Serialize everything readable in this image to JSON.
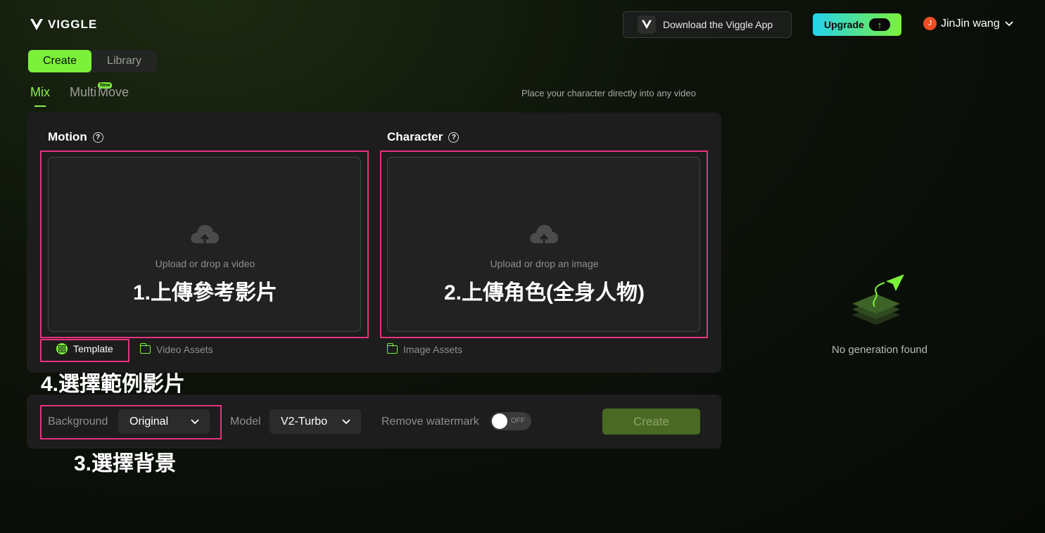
{
  "header": {
    "logo_text": "VIGGLE",
    "download_label": "Download the Viggle App",
    "upgrade_label": "Upgrade",
    "user_initial": "J",
    "user_name": "JinJin wang"
  },
  "main_tabs": [
    {
      "label": "Create",
      "active": true
    },
    {
      "label": "Library",
      "active": false
    }
  ],
  "mode_tabs": [
    {
      "label": "Mix",
      "active": true
    },
    {
      "label": "Multi",
      "badge": "New"
    },
    {
      "label": "Move"
    }
  ],
  "subtitle": "Place your character directly into any video",
  "motion": {
    "title": "Motion",
    "hint": "Upload or drop a video",
    "annotation": "1.上傳參考影片",
    "template_label": "Template",
    "assets_label": "Video Assets"
  },
  "character": {
    "title": "Character",
    "hint": "Upload or drop an image",
    "annotation": "2.上傳角色(全身人物)",
    "assets_label": "Image Assets"
  },
  "annotations": {
    "template": "4.選擇範例影片",
    "background": "3.選擇背景"
  },
  "options": {
    "background_label": "Background",
    "background_value": "Original",
    "model_label": "Model",
    "model_value": "V2-Turbo",
    "watermark_label": "Remove watermark",
    "watermark_state": "OFF",
    "create_label": "Create"
  },
  "empty_state": "No generation found",
  "colors": {
    "accent": "#7cf13a",
    "annotation": "#e8317f",
    "avatar": "#f04e23"
  }
}
